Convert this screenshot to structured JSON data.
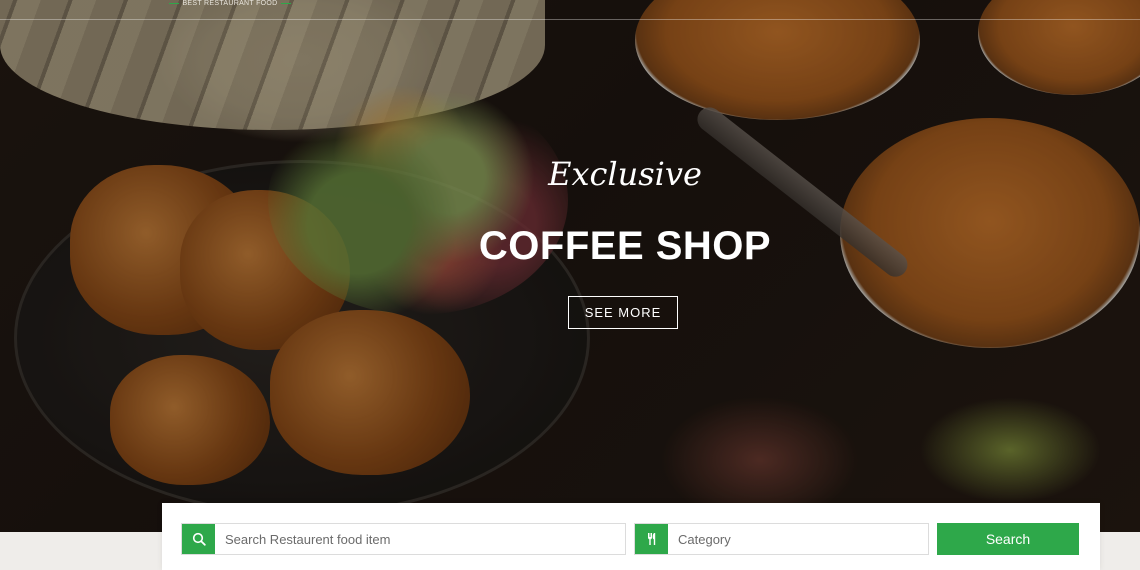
{
  "header": {
    "tagline": "BEST RESTAURANT FOOD"
  },
  "hero": {
    "subtitle": "Exclusive",
    "title": "COFFEE SHOP",
    "cta_label": "SEE MORE"
  },
  "search": {
    "food_placeholder": "Search Restaurent food item",
    "category_placeholder": "Category",
    "button_label": "Search",
    "food_icon": "search-icon",
    "category_icon": "fork-knife-icon"
  },
  "colors": {
    "accent": "#2ea84a",
    "panel_bg": "#ffffff",
    "page_bg": "#efedea"
  }
}
